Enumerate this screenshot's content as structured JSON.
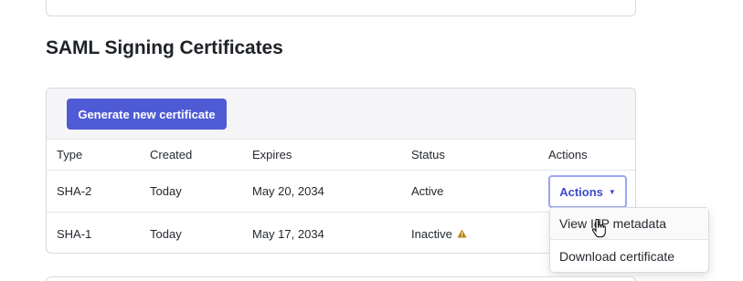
{
  "section": {
    "title": "SAML Signing Certificates"
  },
  "toolbar": {
    "generate_label": "Generate new certificate"
  },
  "table": {
    "headers": {
      "type": "Type",
      "created": "Created",
      "expires": "Expires",
      "status": "Status",
      "actions": "Actions"
    },
    "rows": [
      {
        "type": "SHA-2",
        "created": "Today",
        "expires": "May 20, 2034",
        "status": "Active",
        "action_label": "Actions"
      },
      {
        "type": "SHA-1",
        "created": "Today",
        "expires": "May 17, 2034",
        "status": "Inactive"
      }
    ]
  },
  "dropdown": {
    "items": [
      {
        "label": "View IdP metadata"
      },
      {
        "label": "Download certificate"
      }
    ]
  },
  "icons": {
    "inactive_status": "warning-triangle-icon",
    "caret": "caret-down-icon",
    "cursor": "hand-pointer-icon"
  },
  "colors": {
    "primary": "#4f5bd5",
    "focus_ring": "#9aa6f3",
    "warning": "#b8860b"
  }
}
